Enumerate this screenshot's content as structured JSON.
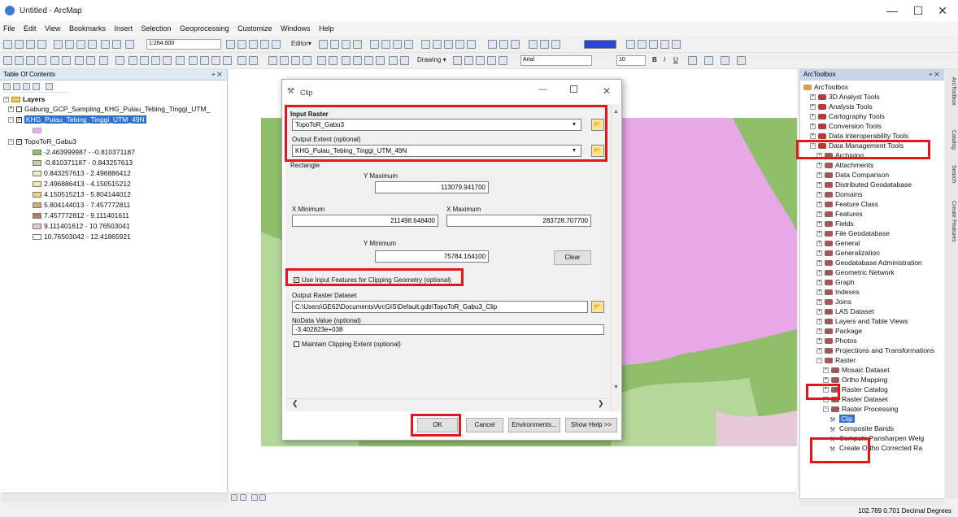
{
  "window": {
    "title": "Untitled - ArcMap",
    "min": "—",
    "max": "☐",
    "close": "✕"
  },
  "menu": [
    "File",
    "Edit",
    "View",
    "Bookmarks",
    "Insert",
    "Selection",
    "Geoprocessing",
    "Customize",
    "Windows",
    "Help"
  ],
  "toolbar": {
    "scale": "1:264.000",
    "editor": "Editor▾",
    "drawing": "Drawing ▾",
    "font": "Arial",
    "font_size": "10"
  },
  "toc": {
    "title": "Table Of Contents",
    "pin": "⌖ ✕",
    "layers_label": "Layers",
    "items": [
      {
        "label": "Gabung_GCP_Sampling_KHG_Pulau_Tebing_Tinggi_UTM_"
      },
      {
        "label": "KHG_Pulau_Tebing_Tinggi_UTM_49N"
      },
      {
        "label": "TopoToR_Gabu3"
      }
    ],
    "legend": [
      {
        "label": "-2.463999987 - -0.810371187",
        "color": "#8fbf6b"
      },
      {
        "label": "-0.810371187 - 0.843257613",
        "color": "#b5d79a"
      },
      {
        "label": "0.843257613 - 2.496886412",
        "color": "#e8f0c6"
      },
      {
        "label": "2.496886413 - 4.150515212",
        "color": "#f4e6b0"
      },
      {
        "label": "4.150515213 - 5.804144012",
        "color": "#f0d27a"
      },
      {
        "label": "5.804144013 - 7.457772811",
        "color": "#d9a96a"
      },
      {
        "label": "7.457772812 - 9.111401611",
        "color": "#b97c6a"
      },
      {
        "label": "9.111401612 - 10.76503041",
        "color": "#e6c9d8"
      },
      {
        "label": "10.76503042 - 12.41865921",
        "color": "#ffffff"
      }
    ]
  },
  "dialog": {
    "title": "Clip",
    "input_raster_label": "Input Raster",
    "input_raster_value": "TopoToR_Gabu3",
    "output_extent_label": "Output Extent (optional)",
    "output_extent_value": "KHG_Pulau_Tebing_Tinggi_UTM_49N",
    "rectangle_label": "Rectangle",
    "ymax_label": "Y Maximum",
    "ymax_value": "113079.941700",
    "xmin_label": "X Minimum",
    "xmin_value": "211498.648400",
    "xmax_label": "X Maximum",
    "xmax_value": "283728.707700",
    "ymin_label": "Y Minimum",
    "ymin_value": "75784.164100",
    "clear_label": "Clear",
    "use_input_features_label": "Use Input Features for Clipping Geometry (optional)",
    "output_raster_label": "Output Raster Dataset",
    "output_raster_value": "C:\\Users\\GE62\\Documents\\ArcGIS\\Default.gdb\\TopoToR_Gabu3_Clip",
    "nodata_label": "NoData Value (optional)",
    "nodata_value": "-3.402823e+038",
    "maintain_label": "Maintain Clipping Extent (optional)",
    "ok_label": "OK",
    "cancel_label": "Cancel",
    "environments_label": "Environments...",
    "show_help_label": "Show Help >>"
  },
  "toolbox": {
    "title": "ArcToolbox",
    "root": "ArcToolbox",
    "items": [
      {
        "label": "3D Analyst Tools"
      },
      {
        "label": "Analysis Tools"
      },
      {
        "label": "Cartography Tools"
      },
      {
        "label": "Conversion Tools"
      },
      {
        "label": "Data Interoperability Tools"
      },
      {
        "label": "Data Management Tools"
      },
      {
        "label": "Archiving"
      },
      {
        "label": "Attachments"
      },
      {
        "label": "Data Comparison"
      },
      {
        "label": "Distributed Geodatabase"
      },
      {
        "label": "Domains"
      },
      {
        "label": "Feature Class"
      },
      {
        "label": "Features"
      },
      {
        "label": "Fields"
      },
      {
        "label": "File Geodatabase"
      },
      {
        "label": "General"
      },
      {
        "label": "Generalization"
      },
      {
        "label": "Geodatabase Administration"
      },
      {
        "label": "Geometric Network"
      },
      {
        "label": "Graph"
      },
      {
        "label": "Indexes"
      },
      {
        "label": "Joins"
      },
      {
        "label": "LAS Dataset"
      },
      {
        "label": "Layers and Table Views"
      },
      {
        "label": "Package"
      },
      {
        "label": "Photos"
      },
      {
        "label": "Projections and Transformations"
      },
      {
        "label": "Raster"
      },
      {
        "label": "Mosaic Dataset"
      },
      {
        "label": "Ortho Mapping"
      },
      {
        "label": "Raster Catalog"
      },
      {
        "label": "Raster Dataset"
      },
      {
        "label": "Raster Processing"
      },
      {
        "label": "Clip"
      },
      {
        "label": "Composite Bands"
      },
      {
        "label": "Compute Pansharpen Weig"
      },
      {
        "label": "Create Ortho Corrected Ra"
      }
    ]
  },
  "side_tabs": [
    "ArcToolbox",
    "Catalog",
    "Search",
    "Create Features"
  ],
  "status": {
    "coords": "102.789  0.701 Decimal Degrees"
  }
}
